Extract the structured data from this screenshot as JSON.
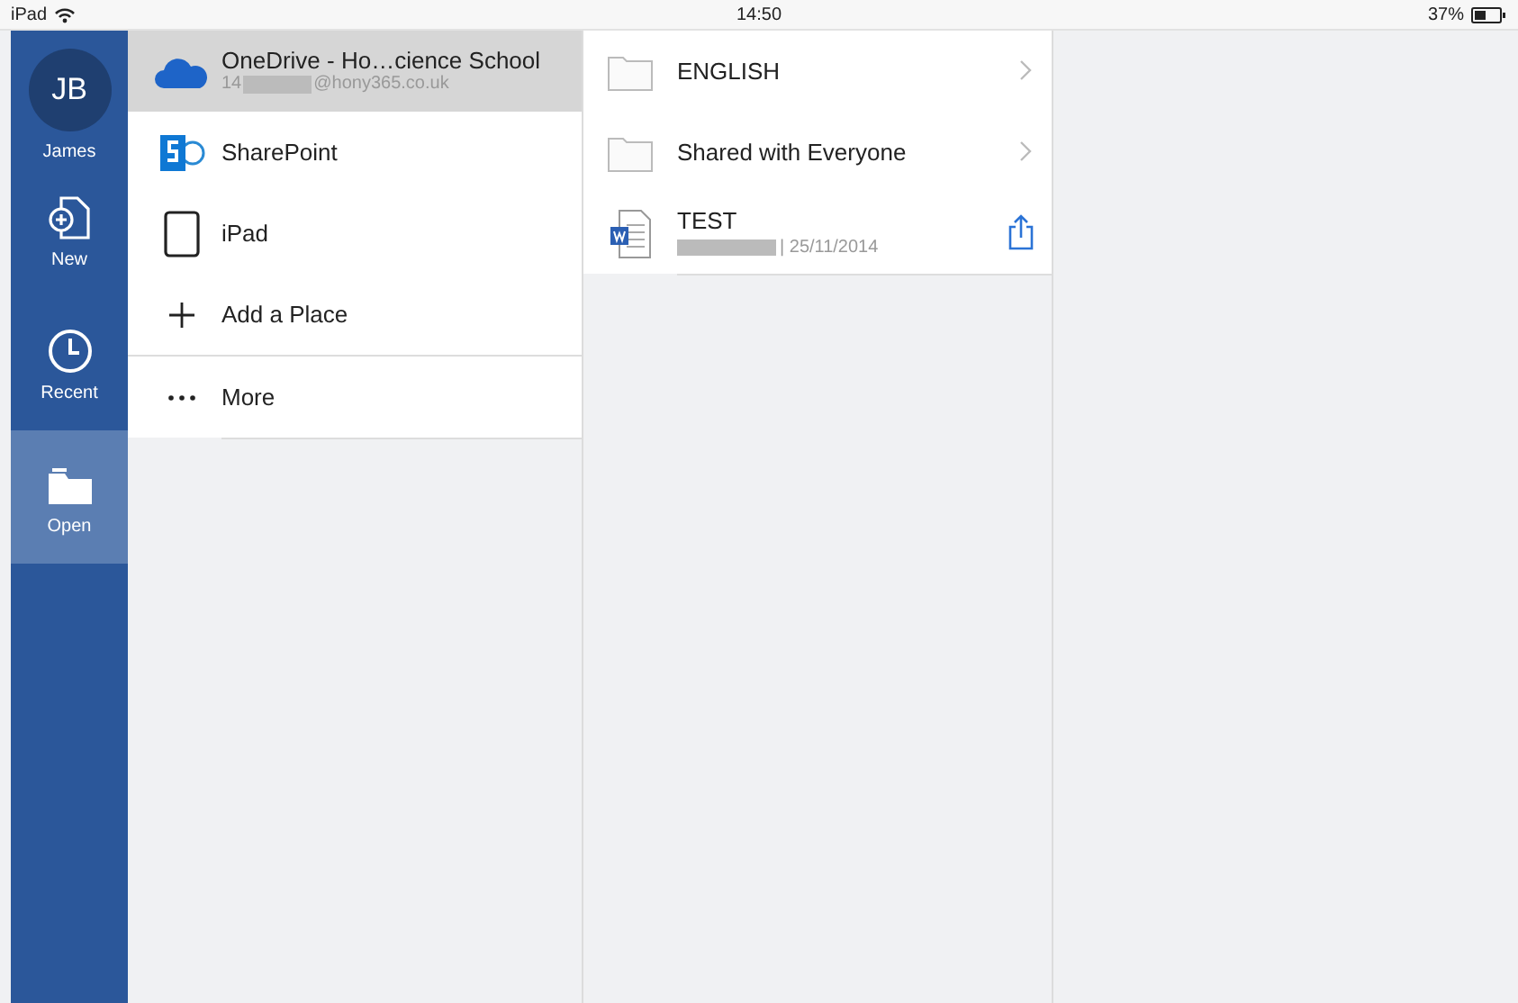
{
  "status_bar": {
    "device": "iPad",
    "time": "14:50",
    "battery": "37%"
  },
  "sidebar": {
    "profile": {
      "initials": "JB",
      "name": "James"
    },
    "items": [
      {
        "kind": "new",
        "label": "New",
        "selected": false
      },
      {
        "kind": "recent",
        "label": "Recent",
        "selected": false
      },
      {
        "kind": "open",
        "label": "Open",
        "selected": true
      }
    ]
  },
  "places": [
    {
      "kind": "cloud",
      "title": "OneDrive - Ho…cience School",
      "subtitle_start": "14",
      "subtitle_end": "@hony365.co.uk",
      "selected": true
    },
    {
      "kind": "sharepoint",
      "title": "SharePoint",
      "selected": false
    },
    {
      "kind": "tablet",
      "title": "iPad",
      "selected": false
    },
    {
      "kind": "add",
      "title": "Add a Place",
      "selected": false
    },
    {
      "kind": "more",
      "title": "More",
      "selected": false
    }
  ],
  "files": [
    {
      "kind": "folder",
      "name": "ENGLISH"
    },
    {
      "kind": "folder",
      "name": "Shared with Everyone"
    },
    {
      "kind": "document",
      "name": "TEST",
      "detail": "| 25/11/2014"
    }
  ]
}
